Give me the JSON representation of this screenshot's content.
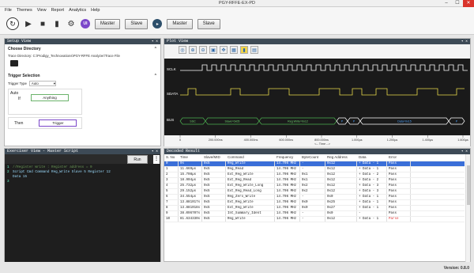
{
  "window": {
    "title": "PGY-RFFE-EX-PD"
  },
  "menu": [
    "File",
    "Themes",
    "View",
    "Report",
    "Analytics",
    "Help"
  ],
  "toolbar": {
    "ui_label": "UI",
    "master1": "Master",
    "slave1": "Slave",
    "master2": "Master",
    "slave2": "Slave"
  },
  "setup": {
    "header": "Setup View",
    "dir_title": "Choose Directory",
    "dir_path": "Trace Directory: C:\\Prodigy_Technovations\\PGY-RFFE Analyzer\\Trace File",
    "trig_title": "Trigger Selection",
    "trig_type_label": "Trigger Type",
    "trig_type_value": "Auto",
    "auto_label": "Auto",
    "if_label": "If",
    "anything": "Anything",
    "then_label": "Then",
    "trigger": "Trigger"
  },
  "exerciser": {
    "header": "Exerciser View - Master Script",
    "run": "Run",
    "lines": [
      {
        "n": "1",
        "text": "//Register Write : Register address = 0"
      },
      {
        "n": "2",
        "text": "Script Cmd Command Reg_Write Slave 5 Register 12"
      },
      {
        "n": "",
        "text": "Data 15"
      },
      {
        "n": "3",
        "text": ""
      }
    ]
  },
  "plot": {
    "header": "Plot View",
    "signals": [
      "SCLK",
      "SDATA",
      "BUS"
    ],
    "bus_labels": [
      "SSC",
      "Slave=0x05",
      "Reg Write=0x12",
      "P",
      "P",
      "Data=0x15",
      "P"
    ],
    "x_ticks": [
      "0",
      "200.000ns",
      "400.000ns",
      "600.000ns",
      "800.000ns",
      "1.000µs",
      "1.200µs",
      "1.400µs",
      "1.600µs"
    ],
    "x_label": "<-- Time -->"
  },
  "decoded": {
    "header": "Decoded Result",
    "columns": [
      "S. No",
      "Time",
      "Slave/MID",
      "Command",
      "Frequency",
      "ByteCount",
      "Reg Address",
      "Data",
      "Error"
    ],
    "rows": [
      [
        "0",
        "0s",
        "0x5",
        "Reg_Write",
        "14.706 MHz",
        "-",
        "0x12",
        "+ Data - 1",
        "Pass"
      ],
      [
        "1",
        "11.669µs",
        "0x5",
        "Reg_Read",
        "14.706 MHz",
        "-",
        "0x12",
        "+ Data - 1",
        "Pass"
      ],
      [
        "2",
        "15.708µs",
        "0x5",
        "Ext_Reg_Write",
        "14.706 MHz",
        "0x1",
        "0x12",
        "+ Data - 2",
        "Pass"
      ],
      [
        "3",
        "18.904µs",
        "0x5",
        "Ext_Reg_Read",
        "14.706 MHz",
        "0x1",
        "0x12",
        "+ Data - 2",
        "Pass"
      ],
      [
        "4",
        "25.732µs",
        "0x5",
        "Ext_Reg_Write_Long",
        "14.706 MHz",
        "0x2",
        "0x12",
        "+ Data - 3",
        "Pass"
      ],
      [
        "5",
        "29.152µs",
        "0x5",
        "Ext_Reg_Read_Long",
        "14.706 MHz",
        "0x2",
        "0x12",
        "+ Data - 3",
        "Pass"
      ],
      [
        "6",
        "34.554µs",
        "0x5",
        "Reg_Zero_Write",
        "14.706 MHz",
        "-",
        "0x0",
        "+ Data - 1",
        "Pass"
      ],
      [
        "7",
        "13.881017s",
        "0x5",
        "Ext_Reg_Write",
        "14.706 MHz",
        "0x0",
        "0x25",
        "+ Data - 1",
        "Pass"
      ],
      [
        "8",
        "13.881018s",
        "0x5",
        "Ext_Reg_Write",
        "14.706 MHz",
        "0x0",
        "0x27",
        "+ Data - 1",
        "Pass"
      ],
      [
        "9",
        "38.096707s",
        "0x5",
        "Int_Summary_Ident",
        "14.706 MHz",
        "-",
        "0x0",
        "-",
        "Pass"
      ],
      [
        "10",
        "81.634330s",
        "0x5",
        "Reg_Write",
        "14.706 MHz",
        "-",
        "0x12",
        "+ Data - 1",
        "Parse"
      ]
    ]
  },
  "status": {
    "version": "Version: 0.8.0"
  }
}
